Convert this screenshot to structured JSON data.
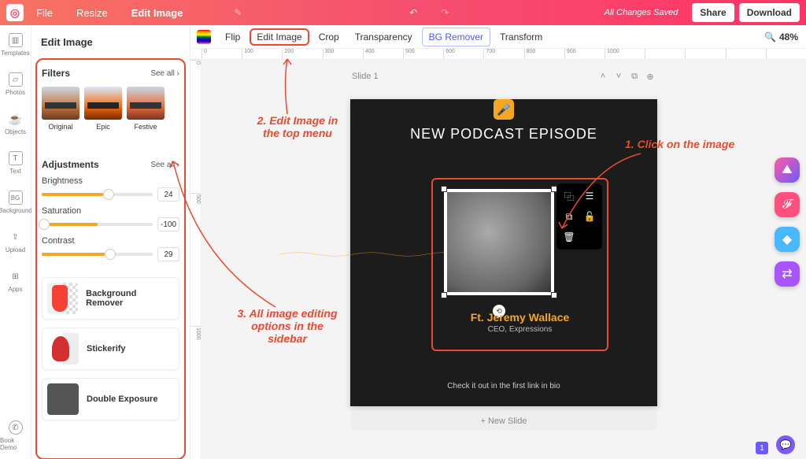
{
  "topbar": {
    "file": "File",
    "resize": "Resize",
    "edit": "Edit Image",
    "autosave": "All Changes Saved",
    "share": "Share",
    "download": "Download"
  },
  "rail": {
    "templates": "Templates",
    "photos": "Photos",
    "objects": "Objects",
    "text": "Text",
    "background": "Background",
    "upload": "Upload",
    "apps": "Apps",
    "bookdemo": "Book Demo"
  },
  "panel": {
    "title": "Edit Image",
    "filters": {
      "title": "Filters",
      "seeall": "See all ›",
      "items": [
        "Original",
        "Epic",
        "Festive"
      ]
    },
    "adjust": {
      "title": "Adjustments",
      "seeall": "See all ›",
      "brightness": {
        "label": "Brightness",
        "value": "24"
      },
      "saturation": {
        "label": "Saturation",
        "value": "-100"
      },
      "contrast": {
        "label": "Contrast",
        "value": "29"
      }
    },
    "tools": {
      "bgremove": "Background Remover",
      "stickerify": "Stickerify",
      "doubleexp": "Double Exposure"
    }
  },
  "toolbar": {
    "flip": "Flip",
    "editimage": "Edit Image",
    "crop": "Crop",
    "transparency": "Transparency",
    "bgremover": "BG Remover",
    "transform": "Transform",
    "zoom": "48%"
  },
  "ruler_x": [
    "0",
    "100",
    "200",
    "300",
    "400",
    "500",
    "600",
    "700",
    "800",
    "900",
    "1000"
  ],
  "ruler_y": [
    "0",
    "500",
    "1000"
  ],
  "slide": {
    "label": "Slide 1",
    "title": "NEW PODCAST EPISODE",
    "guest": "Ft. Jeremy Wallace",
    "role": "CEO, Expressions",
    "footer": "Check it out in the first link in bio",
    "newslide": "+ New Slide"
  },
  "annot": {
    "a1": "1. Click on the image",
    "a2": "2. Edit Image in the top menu",
    "a3": "3. All image editing options in the sidebar"
  },
  "badge": "1"
}
